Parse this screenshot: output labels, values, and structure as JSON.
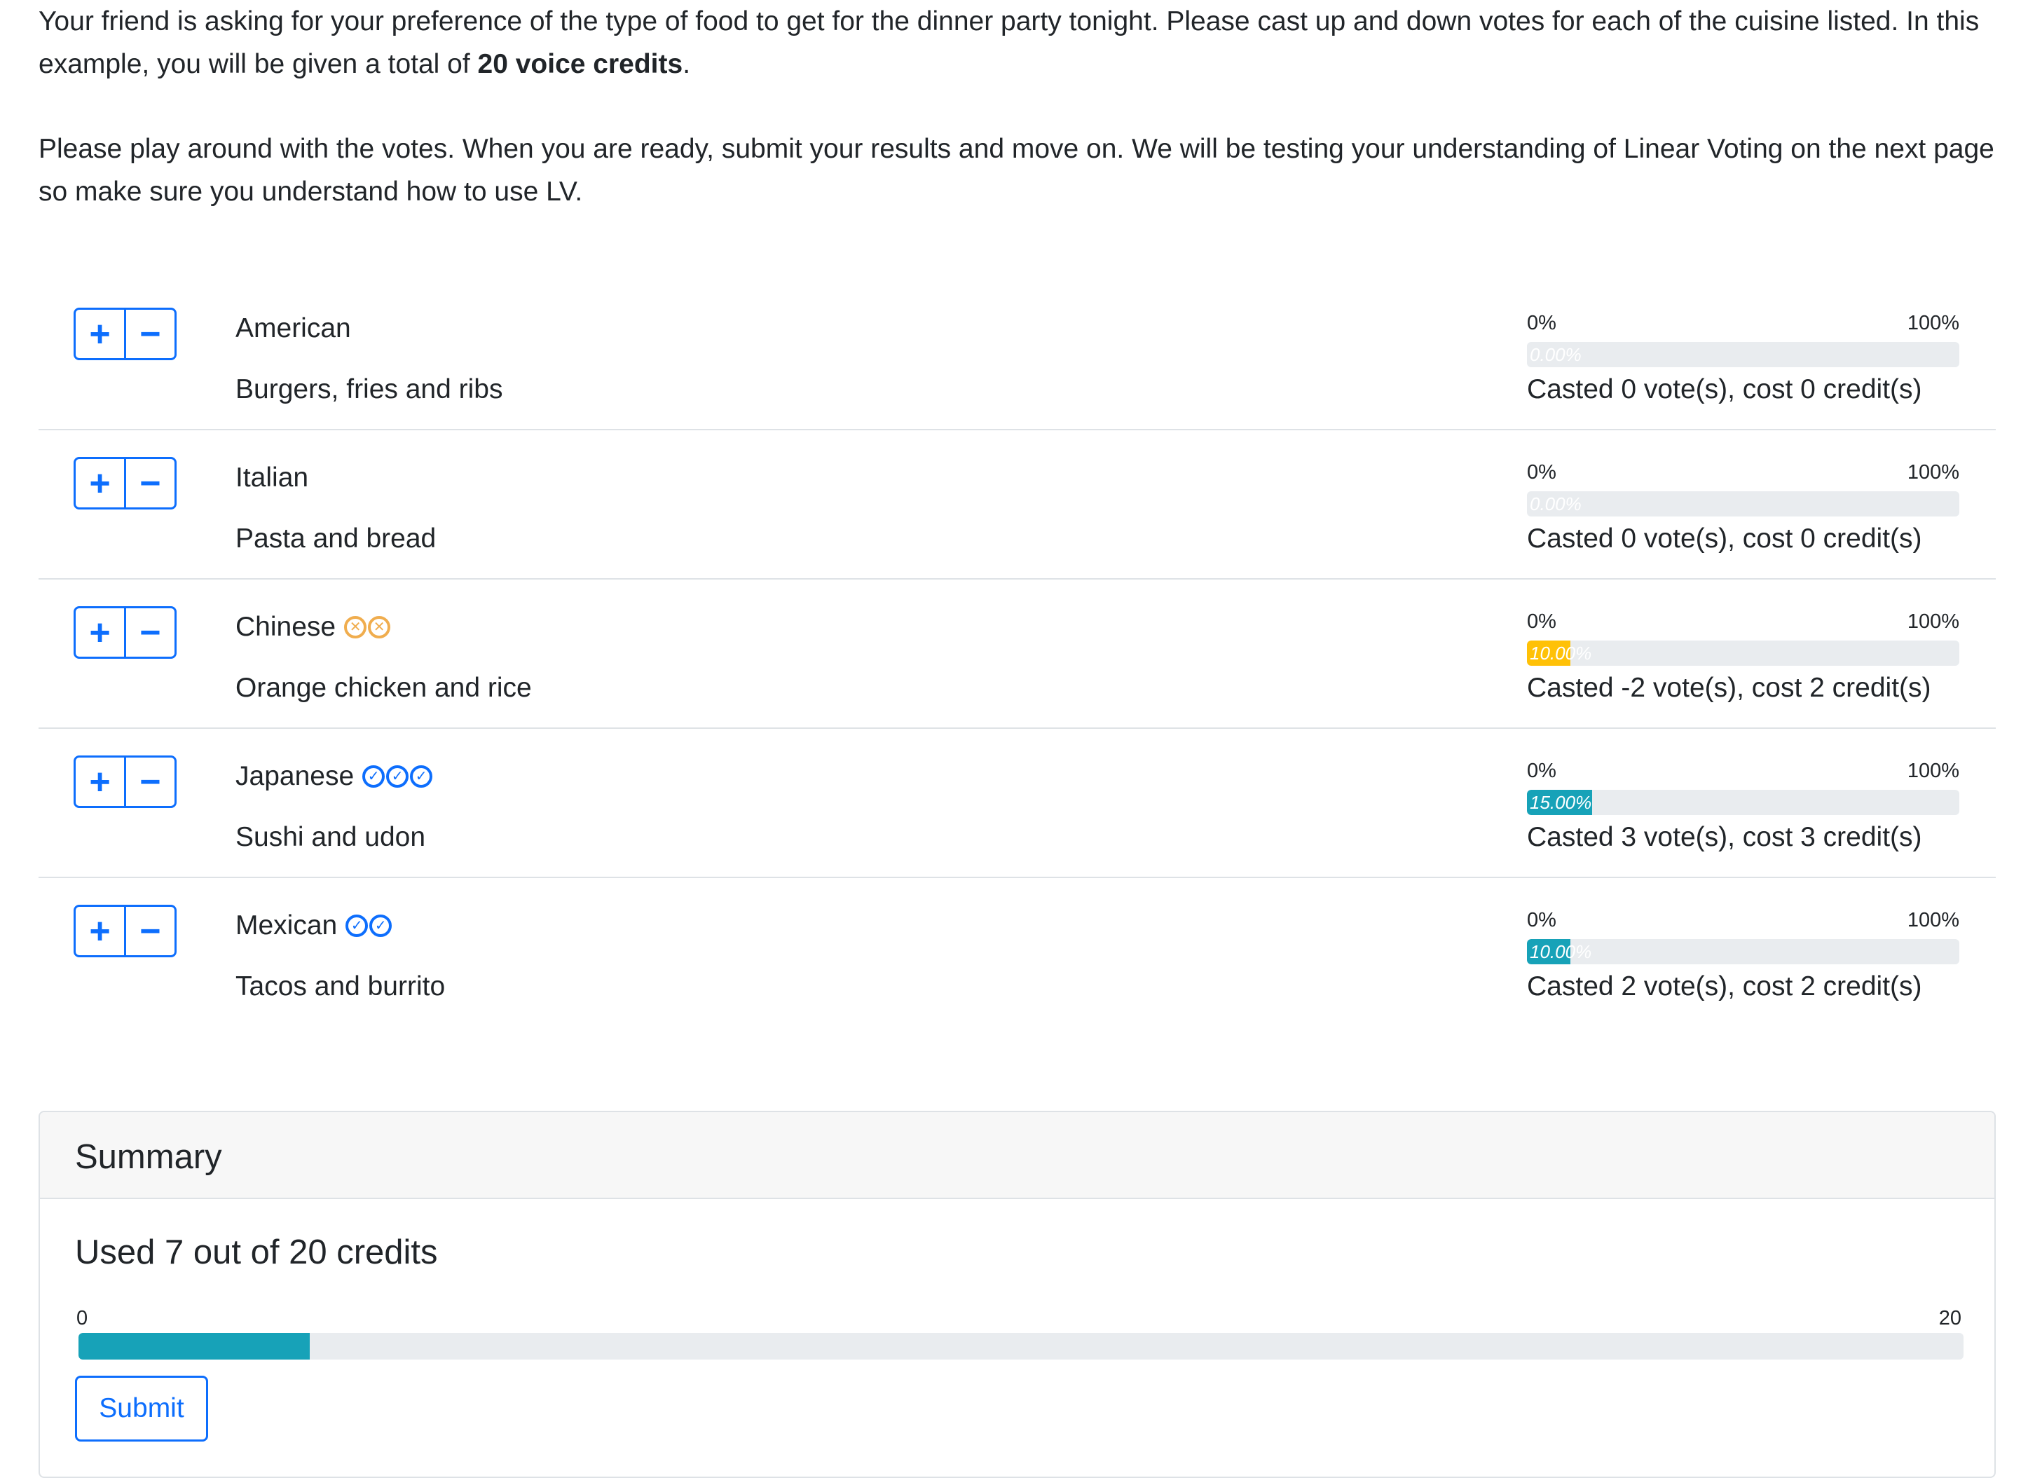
{
  "intro": {
    "p1_start": "Your friend is asking for your preference of the type of food to get for the dinner party tonight. Please cast up and down votes for each of the cuisine listed. In this example, you will be given a total of ",
    "p1_bold": "20 voice credits",
    "p1_end": ".",
    "p2": "Please play around with the votes. When you are ready, submit your results and move on. We will be testing your understanding of Linear Voting on the next page so make sure you understand how to use LV."
  },
  "controls": {
    "plus": "+",
    "minus": "−"
  },
  "scale": {
    "min": "0%",
    "max": "100%"
  },
  "options": [
    {
      "name": "American",
      "desc": "Burgers, fries and ribs",
      "votes": 0,
      "percent": 0,
      "percent_label": "0.00%",
      "cast_text": "Casted 0 vote(s), cost 0 credit(s)",
      "bar_color": "#17a2b8"
    },
    {
      "name": "Italian",
      "desc": "Pasta and bread",
      "votes": 0,
      "percent": 0,
      "percent_label": "0.00%",
      "cast_text": "Casted 0 vote(s), cost 0 credit(s)",
      "bar_color": "#17a2b8"
    },
    {
      "name": "Chinese",
      "desc": "Orange chicken and rice",
      "votes": -2,
      "percent": 10,
      "percent_label": "10.00%",
      "cast_text": "Casted -2 vote(s), cost 2 credit(s)",
      "bar_color": "#ffc107"
    },
    {
      "name": "Japanese",
      "desc": "Sushi and udon",
      "votes": 3,
      "percent": 15,
      "percent_label": "15.00%",
      "cast_text": "Casted 3 vote(s), cost 3 credit(s)",
      "bar_color": "#17a2b8"
    },
    {
      "name": "Mexican",
      "desc": "Tacos and burrito",
      "votes": 2,
      "percent": 10,
      "percent_label": "10.00%",
      "cast_text": "Casted 2 vote(s), cost 2 credit(s)",
      "bar_color": "#17a2b8"
    }
  ],
  "icons": {
    "upvote": "check-circle-icon",
    "downvote": "x-circle-icon"
  },
  "summary": {
    "title": "Summary",
    "used_text": "Used 7 out of 20 credits",
    "used": 7,
    "total": 20,
    "min_label": "0",
    "max_label": "20",
    "submit_label": "Submit"
  }
}
